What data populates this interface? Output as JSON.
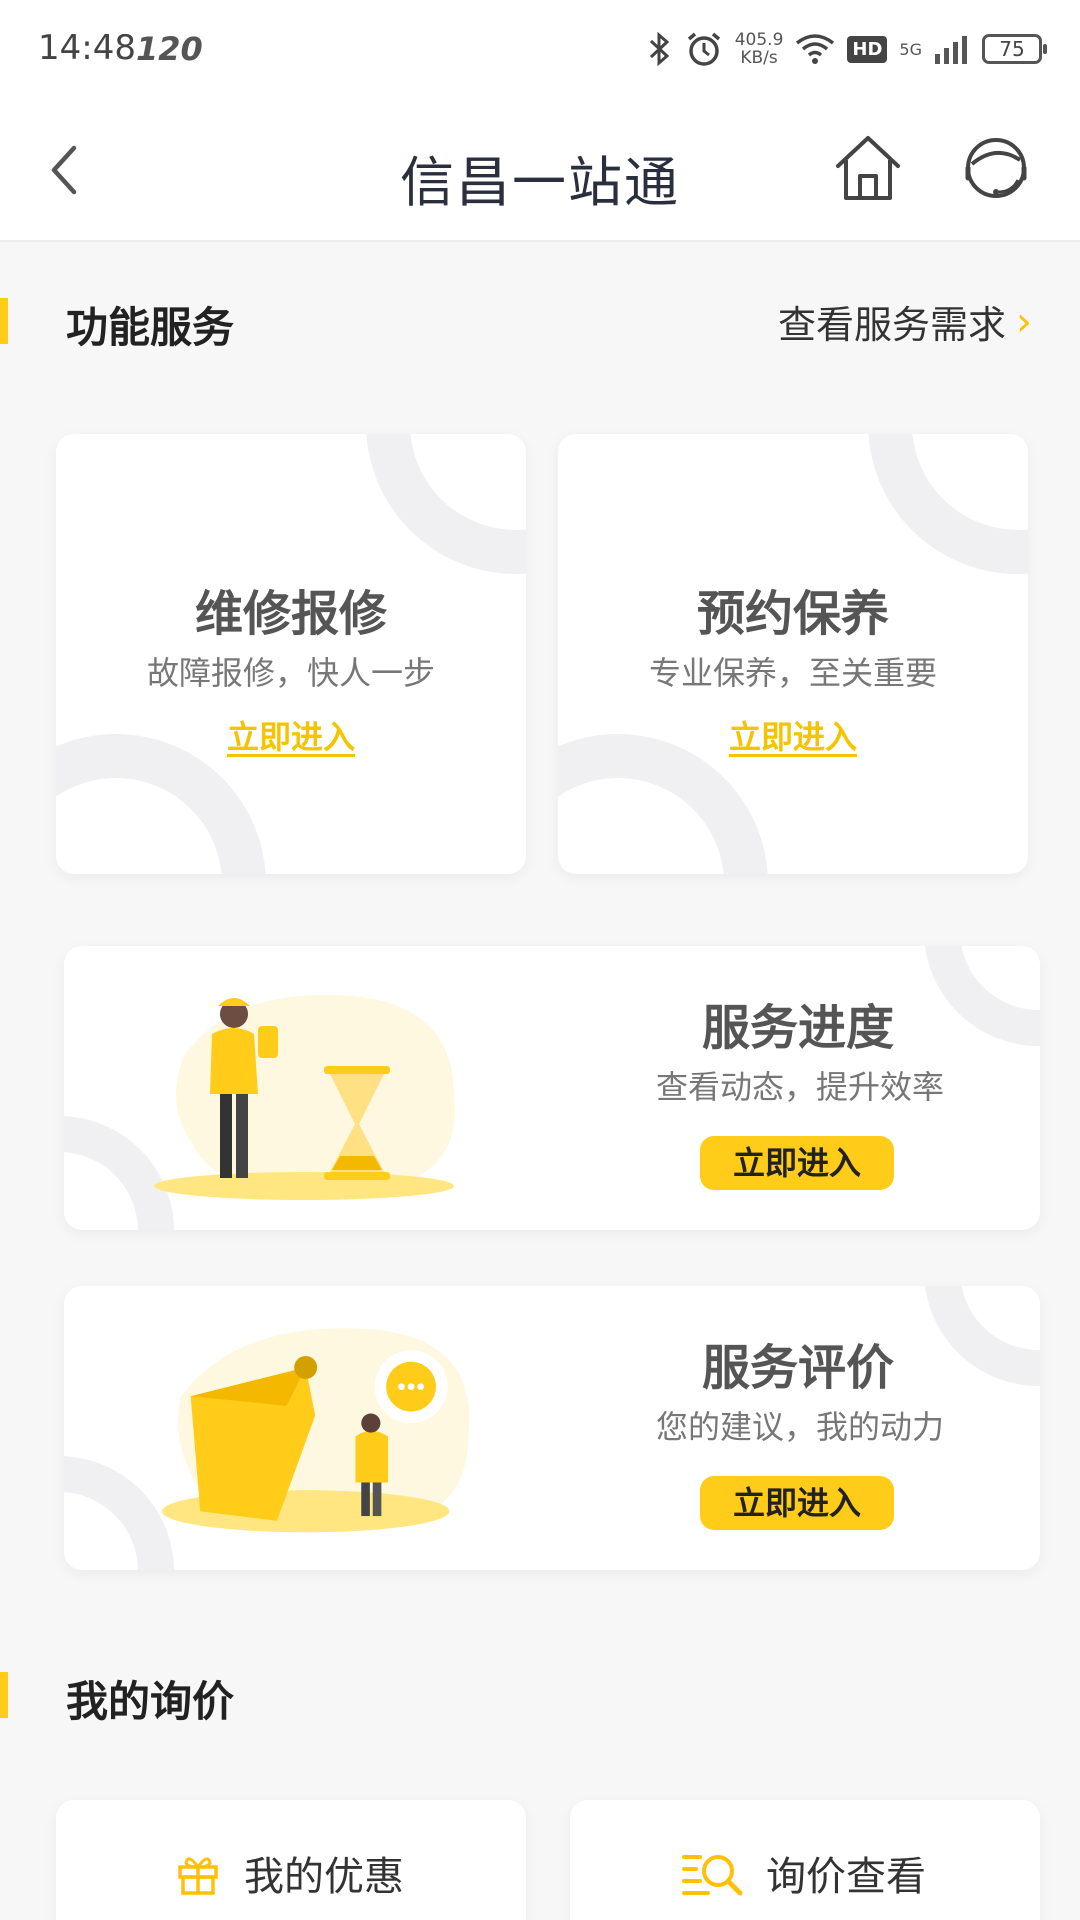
{
  "status_bar": {
    "time": "14:48",
    "refresh_rate": "120",
    "net_speed_value": "405.9",
    "net_speed_unit": "KB/s",
    "hd": "HD",
    "network": "5G",
    "battery": "75"
  },
  "header": {
    "title": "信昌一站通"
  },
  "functions_section": {
    "title": "功能服务",
    "more_link": "查看服务需求"
  },
  "cards": {
    "repair": {
      "title": "维修报修",
      "subtitle": "故障报修，快人一步",
      "action": "立即进入"
    },
    "maintenance": {
      "title": "预约保养",
      "subtitle": "专业保养，至关重要",
      "action": "立即进入"
    },
    "progress": {
      "title": "服务进度",
      "subtitle": "查看动态，提升效率",
      "action": "立即进入"
    },
    "review": {
      "title": "服务评价",
      "subtitle": "您的建议，我的动力",
      "action": "立即进入"
    }
  },
  "inquiry_section": {
    "title": "我的询价",
    "items": [
      {
        "label": "我的优惠",
        "icon": "gift-icon"
      },
      {
        "label": "询价查看",
        "icon": "search-list-icon"
      }
    ]
  },
  "colors": {
    "accent": "#ffcc1a",
    "background": "#f7f7f8",
    "title": "#2a2f3e"
  }
}
